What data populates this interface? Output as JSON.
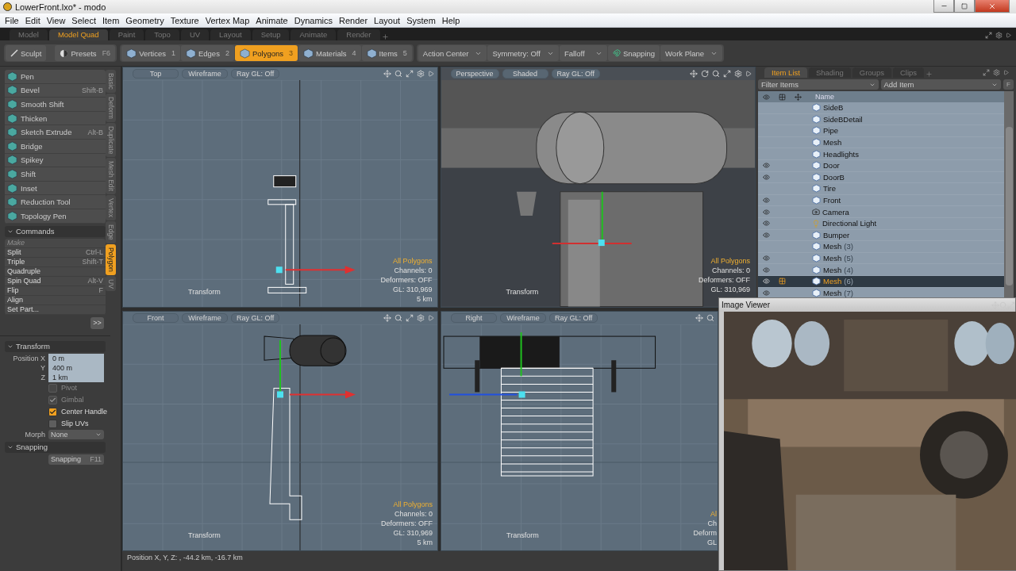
{
  "window": {
    "title": "LowerFront.lxo* - modo"
  },
  "menu": [
    "File",
    "Edit",
    "View",
    "Select",
    "Item",
    "Geometry",
    "Texture",
    "Vertex Map",
    "Animate",
    "Dynamics",
    "Render",
    "Layout",
    "System",
    "Help"
  ],
  "layout_tabs": [
    {
      "label": "Model",
      "selected": false
    },
    {
      "label": "Model Quad",
      "selected": true
    },
    {
      "label": "Paint",
      "selected": false
    },
    {
      "label": "Topo",
      "selected": false
    },
    {
      "label": "UV",
      "selected": false
    },
    {
      "label": "Layout",
      "selected": false
    },
    {
      "label": "Setup",
      "selected": false
    },
    {
      "label": "Animate",
      "selected": false
    },
    {
      "label": "Render",
      "selected": false
    }
  ],
  "toolbar": {
    "sculpt": "Sculpt",
    "presets": {
      "label": "Presets",
      "shortcut": "F6"
    },
    "modes": [
      {
        "label": "Vertices",
        "shortcut": "1",
        "selected": false
      },
      {
        "label": "Edges",
        "shortcut": "2",
        "selected": false
      },
      {
        "label": "Polygons",
        "shortcut": "3",
        "selected": true
      },
      {
        "label": "Materials",
        "shortcut": "4",
        "selected": false
      },
      {
        "label": "Items",
        "shortcut": "5",
        "selected": false
      }
    ],
    "controls": [
      {
        "label": "Action Center",
        "kind": "dropdown"
      },
      {
        "label": "Symmetry: Off",
        "kind": "dropdown"
      },
      {
        "label": "Falloff",
        "kind": "dropdown"
      },
      {
        "label": "Snapping",
        "kind": "snap"
      },
      {
        "label": "Work Plane",
        "kind": "dropdown"
      }
    ]
  },
  "tools": [
    {
      "label": "Pen"
    },
    {
      "label": "Bevel",
      "shortcut": "Shift-B"
    },
    {
      "label": "Smooth Shift"
    },
    {
      "label": "Thicken"
    },
    {
      "label": "Sketch Extrude",
      "shortcut": "Alt-B"
    },
    {
      "label": "Bridge"
    },
    {
      "label": "Spikey"
    },
    {
      "label": "Shift"
    },
    {
      "label": "Inset"
    },
    {
      "label": "Reduction Tool"
    },
    {
      "label": "Topology Pen"
    }
  ],
  "side_tabs": [
    {
      "label": "Basic",
      "selected": false
    },
    {
      "label": "Deform",
      "selected": false
    },
    {
      "label": "Duplicate",
      "selected": false
    },
    {
      "label": "Mesh Edit",
      "selected": false
    },
    {
      "label": "Vertex",
      "selected": false
    },
    {
      "label": "Edge",
      "selected": false
    },
    {
      "label": "Polygon",
      "selected": true
    },
    {
      "label": "UV",
      "selected": false
    }
  ],
  "commands": {
    "title": "Commands",
    "items": [
      {
        "label": "Make",
        "disabled": true
      },
      {
        "label": "Split",
        "shortcut": "Ctrl-L",
        "disabled": false
      },
      {
        "label": "Triple",
        "shortcut": "Shift-T",
        "disabled": false
      },
      {
        "label": "Quadruple",
        "disabled": false
      },
      {
        "label": "Spin Quad",
        "shortcut": "Alt-V",
        "disabled": false
      },
      {
        "label": "Flip",
        "shortcut": "F",
        "disabled": false
      },
      {
        "label": "Align",
        "disabled": false
      },
      {
        "label": "Set Part...",
        "disabled": false
      }
    ],
    "more": ">>"
  },
  "transform": {
    "title": "Transform",
    "position": [
      {
        "axis": "Position X",
        "value": "0 m"
      },
      {
        "axis": "Y",
        "value": "400 m"
      },
      {
        "axis": "Z",
        "value": "1 km"
      }
    ],
    "options": [
      {
        "label": "Pivot",
        "checked": false,
        "disabled": true
      },
      {
        "label": "Gimbal",
        "checked": true,
        "disabled": true
      },
      {
        "label": "Center Handle",
        "checked": true,
        "disabled": false
      },
      {
        "label": "Slip UVs",
        "checked": false,
        "disabled": false
      }
    ],
    "morph": {
      "label": "Morph",
      "value": "None"
    }
  },
  "snapping": {
    "title": "Snapping",
    "button": {
      "label": "Snapping",
      "shortcut": "F11"
    }
  },
  "viewports": [
    {
      "view": "Top",
      "shading": "Wireframe",
      "ray_gl": "Ray GL: Off",
      "kind": "top",
      "tool": "Transform",
      "info": [
        "All Polygons",
        "Channels: 0",
        "Deformers: OFF",
        "GL: 310,969",
        "5 km"
      ]
    },
    {
      "view": "Perspective",
      "shading": "Shaded",
      "ray_gl": "Ray GL: Off",
      "kind": "perspective",
      "tool": "Transform",
      "info": [
        "All Polygons",
        "Channels: 0",
        "Deformers: OFF",
        "GL: 310,969"
      ]
    },
    {
      "view": "Front",
      "shading": "Wireframe",
      "ray_gl": "Ray GL: Off",
      "kind": "front",
      "tool": "Transform",
      "info": [
        "All Polygons",
        "Channels: 0",
        "Deformers: OFF",
        "GL: 310,969",
        "5 km"
      ]
    },
    {
      "view": "Right",
      "shading": "Wireframe",
      "ray_gl": "Ray GL: Off",
      "kind": "right",
      "tool": "Transform",
      "info": [
        "Al",
        "Ch",
        "Deform",
        "GL"
      ]
    }
  ],
  "status_bar": "Position X, Y, Z:  , -44.2 km, -16.7 km",
  "item_list": {
    "tabs": [
      {
        "label": "Item List",
        "selected": true
      },
      {
        "label": "Shading",
        "selected": false
      },
      {
        "label": "Groups",
        "selected": false
      },
      {
        "label": "Clips",
        "selected": false
      }
    ],
    "filter": "Filter Items",
    "add": "Add Item",
    "f_button": "F",
    "column": "Name",
    "items": [
      {
        "name": "SideB",
        "kind": "mesh",
        "visible": false,
        "selected": false
      },
      {
        "name": "SideBDetail",
        "kind": "mesh",
        "visible": false,
        "selected": false
      },
      {
        "name": "Pipe",
        "kind": "mesh",
        "visible": false,
        "selected": false
      },
      {
        "name": "Mesh",
        "kind": "mesh",
        "visible": false,
        "selected": false
      },
      {
        "name": "Headlights",
        "kind": "mesh",
        "visible": false,
        "selected": false
      },
      {
        "name": "Door",
        "kind": "mesh",
        "visible": true,
        "selected": false
      },
      {
        "name": "DoorB",
        "kind": "mesh",
        "visible": true,
        "selected": false
      },
      {
        "name": "Tire",
        "kind": "mesh",
        "visible": false,
        "selected": false
      },
      {
        "name": "Front",
        "kind": "mesh",
        "visible": true,
        "selected": false
      },
      {
        "name": "Camera",
        "kind": "camera",
        "visible": true,
        "selected": false
      },
      {
        "name": "Directional Light",
        "kind": "light",
        "visible": true,
        "selected": false
      },
      {
        "name": "Bumper",
        "kind": "mesh",
        "visible": true,
        "selected": false
      },
      {
        "name": "Mesh",
        "count": "(3)",
        "kind": "mesh",
        "visible": false,
        "selected": false
      },
      {
        "name": "Mesh",
        "count": "(5)",
        "kind": "mesh",
        "visible": true,
        "selected": false
      },
      {
        "name": "Mesh",
        "count": "(4)",
        "kind": "mesh",
        "visible": true,
        "selected": false
      },
      {
        "name": "Mesh",
        "count": "(6)",
        "kind": "mesh",
        "visible": true,
        "selected": true
      },
      {
        "name": "Mesh",
        "count": "(7)",
        "kind": "mesh",
        "visible": true,
        "selected": false
      }
    ]
  },
  "image_viewer": {
    "title": "Image Viewer"
  }
}
